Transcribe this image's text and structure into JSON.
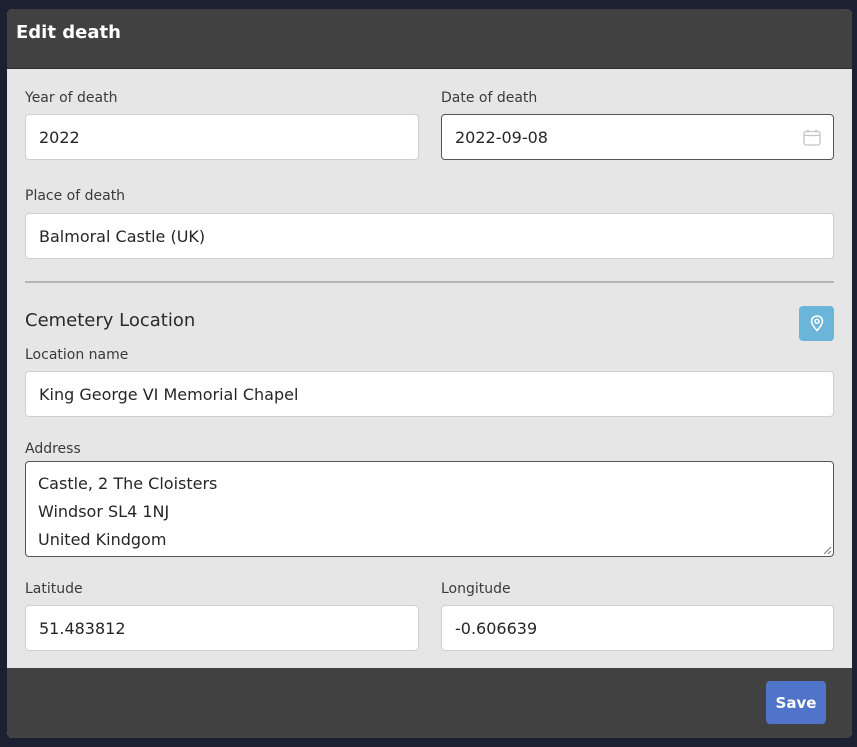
{
  "modal": {
    "title": "Edit death"
  },
  "death": {
    "year_label": "Year of death",
    "year_value": "2022",
    "date_label": "Date of death",
    "date_value": "2022-09-08",
    "place_label": "Place of death",
    "place_value": "Balmoral Castle (UK)"
  },
  "cemetery": {
    "section_title": "Cemetery Location",
    "location_name_label": "Location name",
    "location_name_value": "King George VI Memorial Chapel",
    "address_label": "Address",
    "address_lines": [
      "Castle, 2 The Cloisters",
      "Windsor SL4 1NJ",
      "United Kindgom"
    ],
    "latitude_label": "Latitude",
    "latitude_value": "51.483812",
    "longitude_label": "Longitude",
    "longitude_value": "-0.606639",
    "map_button_icon": "map-pin-icon"
  },
  "footer": {
    "save_label": "Save"
  },
  "colors": {
    "header_bg": "#414141",
    "body_bg": "#e6e6e6",
    "map_button": "#6ab5d9",
    "save_button": "#4f74c9"
  }
}
